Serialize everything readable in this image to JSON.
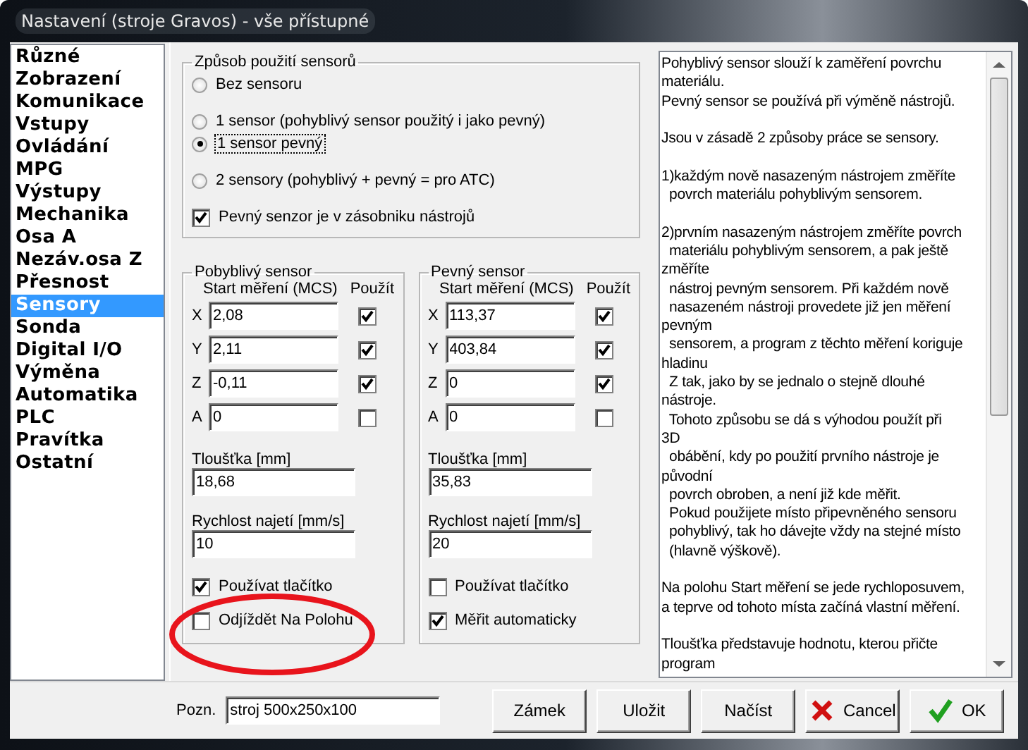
{
  "window": {
    "title": "Nastavení (stroje Gravos) - vše přístupné"
  },
  "sidebar": {
    "items": [
      {
        "label": "Různé",
        "selected": false
      },
      {
        "label": "Zobrazení",
        "selected": false
      },
      {
        "label": "Komunikace",
        "selected": false
      },
      {
        "label": "Vstupy",
        "selected": false
      },
      {
        "label": "Ovládání",
        "selected": false
      },
      {
        "label": "MPG",
        "selected": false
      },
      {
        "label": "Výstupy",
        "selected": false
      },
      {
        "label": "Mechanika",
        "selected": false
      },
      {
        "label": "Osa A",
        "selected": false
      },
      {
        "label": "Nezáv.osa Z",
        "selected": false
      },
      {
        "label": "Přesnost",
        "selected": false
      },
      {
        "label": "Sensory",
        "selected": true
      },
      {
        "label": "Sonda",
        "selected": false
      },
      {
        "label": "Digital I/O",
        "selected": false
      },
      {
        "label": "Výměna",
        "selected": false
      },
      {
        "label": "Automatika",
        "selected": false
      },
      {
        "label": "PLC",
        "selected": false
      },
      {
        "label": "Pravítka",
        "selected": false
      },
      {
        "label": "Ostatní",
        "selected": false
      }
    ]
  },
  "mode_group": {
    "title": "Způsob použití sensorů",
    "options": [
      {
        "label": "Bez sensoru",
        "selected": false
      },
      {
        "label": "1 sensor (pohyblivý sensor použitý i jako pevný)",
        "selected": false
      },
      {
        "label": "1 sensor pevný",
        "selected": true
      },
      {
        "label": "2 sensory (pohyblivý + pevný = pro ATC)",
        "selected": false
      }
    ],
    "checkbox": {
      "label": "Pevný senzor je v zásobniku nástrojů",
      "checked": true
    }
  },
  "sensor_groups": [
    {
      "title": "Pobyblivý sensor",
      "start_label": "Start měření (MCS)",
      "use_label": "Použít",
      "axes": [
        {
          "axis": "X",
          "value": "2,08",
          "checked": true
        },
        {
          "axis": "Y",
          "value": "2,11",
          "checked": true
        },
        {
          "axis": "Z",
          "value": "-0,11",
          "checked": true
        },
        {
          "axis": "A",
          "value": "0",
          "checked": false
        }
      ],
      "thickness_label": "Tloušťka [mm]",
      "thickness": "18,68",
      "speed_label": "Rychlost najetí [mm/s]",
      "speed": "10",
      "checkboxes": [
        {
          "label": "Používat tlačítko",
          "checked": true
        },
        {
          "label": "Odjíždět Na Polohu",
          "checked": false
        }
      ]
    },
    {
      "title": "Pevný sensor",
      "start_label": "Start měření (MCS)",
      "use_label": "Použít",
      "axes": [
        {
          "axis": "X",
          "value": "113,37",
          "checked": true
        },
        {
          "axis": "Y",
          "value": "403,84",
          "checked": true
        },
        {
          "axis": "Z",
          "value": "0",
          "checked": true
        },
        {
          "axis": "A",
          "value": "0",
          "checked": false
        }
      ],
      "thickness_label": "Tloušťka [mm]",
      "thickness": "35,83",
      "speed_label": "Rychlost najetí [mm/s]",
      "speed": "20",
      "checkboxes": [
        {
          "label": "Používat tlačítko",
          "checked": false
        },
        {
          "label": "Měřit automaticky",
          "checked": true
        }
      ]
    }
  ],
  "help_text": "Pohyblivý sensor slouží k zaměření povrchu\nmateriálu.\nPevný sensor se používá při výměně nástrojů.\n\nJsou v zásadě 2 způsoby práce se sensory.\n\n1)každým nově nasazeným nástrojem změříte\n  povrch materiálu pohyblivým sensorem.\n\n2)prvním nasazeným nástrojem změříte povrch\n  materiálu pohyblivým sensorem, a pak ještě\nzměříte\n  nástroj pevným sensorem. Při každém nově\n  nasazeném nástroji provedete již jen měření\npevným\n  sensorem, a program z těchto měření koriguje\nhladinu\n  Z tak, jako by se jednalo o stejně dlouhé\nnástroje.\n  Tohoto způsobu se dá s výhodou použít při\n3D\n  obábění, kdy po použití prvního nástroje je\npůvodní\n  povrch obroben, a není již kde měřit.\n  Pokud použijete místo připevněného sensoru\n  pohyblivý, tak ho dávejte vždy na stejné místo\n  (hlavně výškově).\n\nNa polohu Start měření se jede rychloposuvem,\na teprve od tohoto místa začíná vlastní měření.\n\nTloušťka představuje hodnotu, kterou přičte\nprogram",
  "footer": {
    "note_label": "Pozn.",
    "note": "stroj 500x250x100",
    "buttons": [
      {
        "label": "Zámek",
        "kind": "plain"
      },
      {
        "label": "Uložit",
        "kind": "plain"
      },
      {
        "label": "Načíst",
        "kind": "plain"
      },
      {
        "label": "Cancel",
        "kind": "cancel"
      },
      {
        "label": "OK",
        "kind": "ok"
      }
    ]
  }
}
